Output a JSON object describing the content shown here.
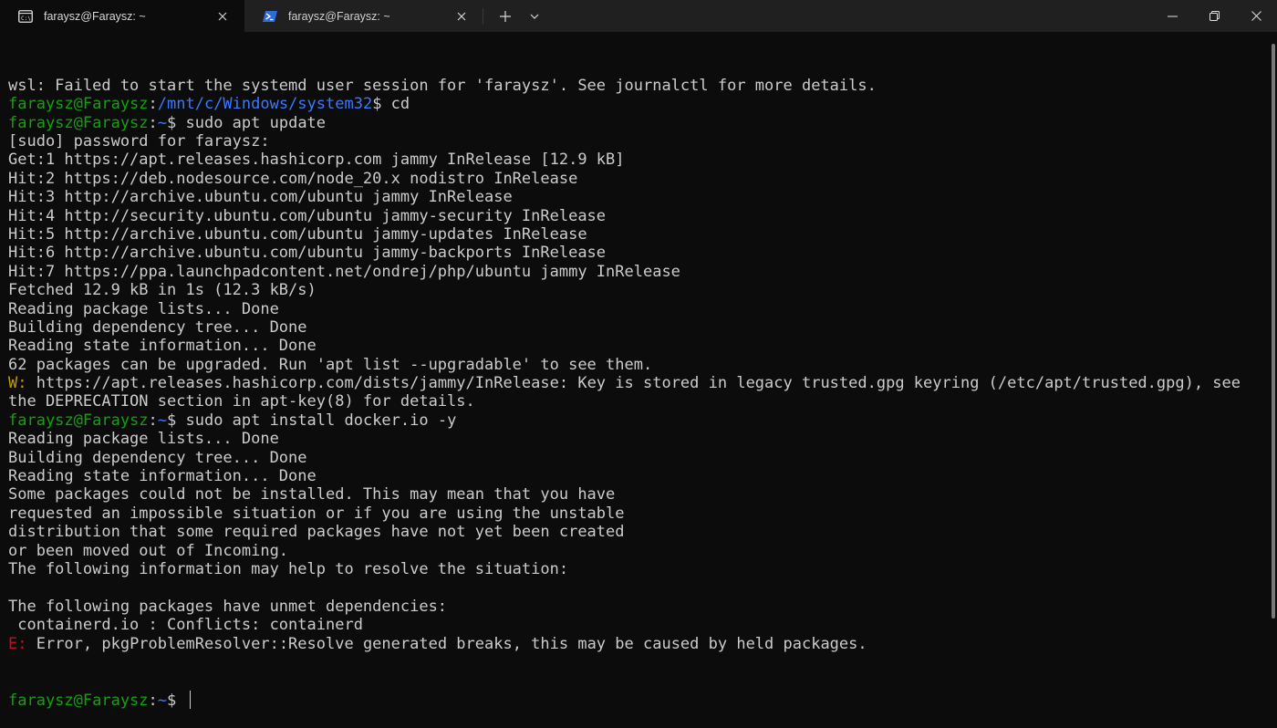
{
  "window": {
    "tabs": [
      {
        "title": "faraysz@Faraysz: ~",
        "icon": "terminal-icon",
        "active": true
      },
      {
        "title": "faraysz@Faraysz: ~",
        "icon": "powershell-icon",
        "active": false
      }
    ]
  },
  "colors": {
    "background": "#0c0c0c",
    "titlebar": "#202020",
    "text": "#cccccc",
    "prompt_user": "#13a10e",
    "prompt_path": "#3b78ff",
    "warning": "#c19c00",
    "error": "#c50f1f"
  },
  "terminal": {
    "lines": [
      {
        "segs": [
          {
            "t": "text",
            "v": "wsl: Failed to start the systemd user session for 'faraysz'. See journalctl for more details."
          }
        ]
      },
      {
        "segs": [
          {
            "t": "user",
            "v": "faraysz@Faraysz"
          },
          {
            "t": "sep",
            "v": ":"
          },
          {
            "t": "path",
            "v": "/mnt/c/Windows/system32"
          },
          {
            "t": "text",
            "v": "$ cd"
          }
        ]
      },
      {
        "segs": [
          {
            "t": "user",
            "v": "faraysz@Faraysz"
          },
          {
            "t": "sep",
            "v": ":"
          },
          {
            "t": "path",
            "v": "~"
          },
          {
            "t": "text",
            "v": "$ sudo apt update"
          }
        ]
      },
      {
        "segs": [
          {
            "t": "text",
            "v": "[sudo] password for faraysz:"
          }
        ]
      },
      {
        "segs": [
          {
            "t": "text",
            "v": "Get:1 https://apt.releases.hashicorp.com jammy InRelease [12.9 kB]"
          }
        ]
      },
      {
        "segs": [
          {
            "t": "text",
            "v": "Hit:2 https://deb.nodesource.com/node_20.x nodistro InRelease"
          }
        ]
      },
      {
        "segs": [
          {
            "t": "text",
            "v": "Hit:3 http://archive.ubuntu.com/ubuntu jammy InRelease"
          }
        ]
      },
      {
        "segs": [
          {
            "t": "text",
            "v": "Hit:4 http://security.ubuntu.com/ubuntu jammy-security InRelease"
          }
        ]
      },
      {
        "segs": [
          {
            "t": "text",
            "v": "Hit:5 http://archive.ubuntu.com/ubuntu jammy-updates InRelease"
          }
        ]
      },
      {
        "segs": [
          {
            "t": "text",
            "v": "Hit:6 http://archive.ubuntu.com/ubuntu jammy-backports InRelease"
          }
        ]
      },
      {
        "segs": [
          {
            "t": "text",
            "v": "Hit:7 https://ppa.launchpadcontent.net/ondrej/php/ubuntu jammy InRelease"
          }
        ]
      },
      {
        "segs": [
          {
            "t": "text",
            "v": "Fetched 12.9 kB in 1s (12.3 kB/s)"
          }
        ]
      },
      {
        "segs": [
          {
            "t": "text",
            "v": "Reading package lists... Done"
          }
        ]
      },
      {
        "segs": [
          {
            "t": "text",
            "v": "Building dependency tree... Done"
          }
        ]
      },
      {
        "segs": [
          {
            "t": "text",
            "v": "Reading state information... Done"
          }
        ]
      },
      {
        "segs": [
          {
            "t": "text",
            "v": "62 packages can be upgraded. Run 'apt list --upgradable' to see them."
          }
        ]
      },
      {
        "segs": [
          {
            "t": "warn",
            "v": "W:"
          },
          {
            "t": "text",
            "v": " https://apt.releases.hashicorp.com/dists/jammy/InRelease: Key is stored in legacy trusted.gpg keyring (/etc/apt/trusted.gpg), see"
          }
        ]
      },
      {
        "segs": [
          {
            "t": "text",
            "v": "the DEPRECATION section in apt-key(8) for details."
          }
        ]
      },
      {
        "segs": [
          {
            "t": "user",
            "v": "faraysz@Faraysz"
          },
          {
            "t": "sep",
            "v": ":"
          },
          {
            "t": "path",
            "v": "~"
          },
          {
            "t": "text",
            "v": "$ sudo apt install docker.io -y"
          }
        ]
      },
      {
        "segs": [
          {
            "t": "text",
            "v": "Reading package lists... Done"
          }
        ]
      },
      {
        "segs": [
          {
            "t": "text",
            "v": "Building dependency tree... Done"
          }
        ]
      },
      {
        "segs": [
          {
            "t": "text",
            "v": "Reading state information... Done"
          }
        ]
      },
      {
        "segs": [
          {
            "t": "text",
            "v": "Some packages could not be installed. This may mean that you have"
          }
        ]
      },
      {
        "segs": [
          {
            "t": "text",
            "v": "requested an impossible situation or if you are using the unstable"
          }
        ]
      },
      {
        "segs": [
          {
            "t": "text",
            "v": "distribution that some required packages have not yet been created"
          }
        ]
      },
      {
        "segs": [
          {
            "t": "text",
            "v": "or been moved out of Incoming."
          }
        ]
      },
      {
        "segs": [
          {
            "t": "text",
            "v": "The following information may help to resolve the situation:"
          }
        ]
      },
      {
        "segs": [
          {
            "t": "text",
            "v": ""
          }
        ]
      },
      {
        "segs": [
          {
            "t": "text",
            "v": "The following packages have unmet dependencies:"
          }
        ]
      },
      {
        "segs": [
          {
            "t": "text",
            "v": " containerd.io : Conflicts: containerd"
          }
        ]
      },
      {
        "segs": [
          {
            "t": "err",
            "v": "E:"
          },
          {
            "t": "text",
            "v": " Error, pkgProblemResolver::Resolve generated breaks, this may be caused by held packages."
          }
        ]
      }
    ],
    "prompt": {
      "user": "faraysz@Faraysz",
      "sep": ":",
      "path": "~",
      "symbol": "$ "
    }
  }
}
